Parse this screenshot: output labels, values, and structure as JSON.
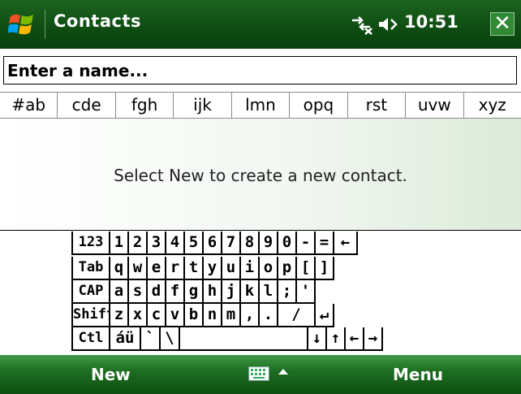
{
  "titlebar": {
    "title": "Contacts",
    "time": "10:51",
    "start_icon": "windows-flag-icon",
    "connectivity_icon": "connectivity-icon",
    "volume_icon": "volume-icon",
    "close_glyph": "✕"
  },
  "search": {
    "placeholder": "Enter a name..."
  },
  "tabs": [
    "#ab",
    "cde",
    "fgh",
    "ijk",
    "lmn",
    "opq",
    "rst",
    "uvw",
    "xyz"
  ],
  "content": {
    "empty_message": "Select New to create a new contact."
  },
  "keyboard": {
    "rows": [
      [
        "123",
        "1",
        "2",
        "3",
        "4",
        "5",
        "6",
        "7",
        "8",
        "9",
        "0",
        "-",
        "=",
        "←"
      ],
      [
        "Tab",
        "q",
        "w",
        "e",
        "r",
        "t",
        "y",
        "u",
        "i",
        "o",
        "p",
        "[",
        "]"
      ],
      [
        "CAP",
        "a",
        "s",
        "d",
        "f",
        "g",
        "h",
        "j",
        "k",
        "l",
        ";",
        "'"
      ],
      [
        "Shift",
        "z",
        "x",
        "c",
        "v",
        "b",
        "n",
        "m",
        ",",
        ".",
        "/",
        "↵"
      ],
      [
        "Ctl",
        "áü",
        "`",
        "\\",
        "",
        "↓",
        "↑",
        "←",
        "→"
      ]
    ]
  },
  "softkeys": {
    "left": "New",
    "right": "Menu",
    "input_icon": "keyboard-icon",
    "arrow_icon": "up-arrow-icon"
  },
  "colors": {
    "titlebar": "#0e4c12",
    "softbar": "#1e6e22",
    "content_tint": "#dcebd9"
  }
}
